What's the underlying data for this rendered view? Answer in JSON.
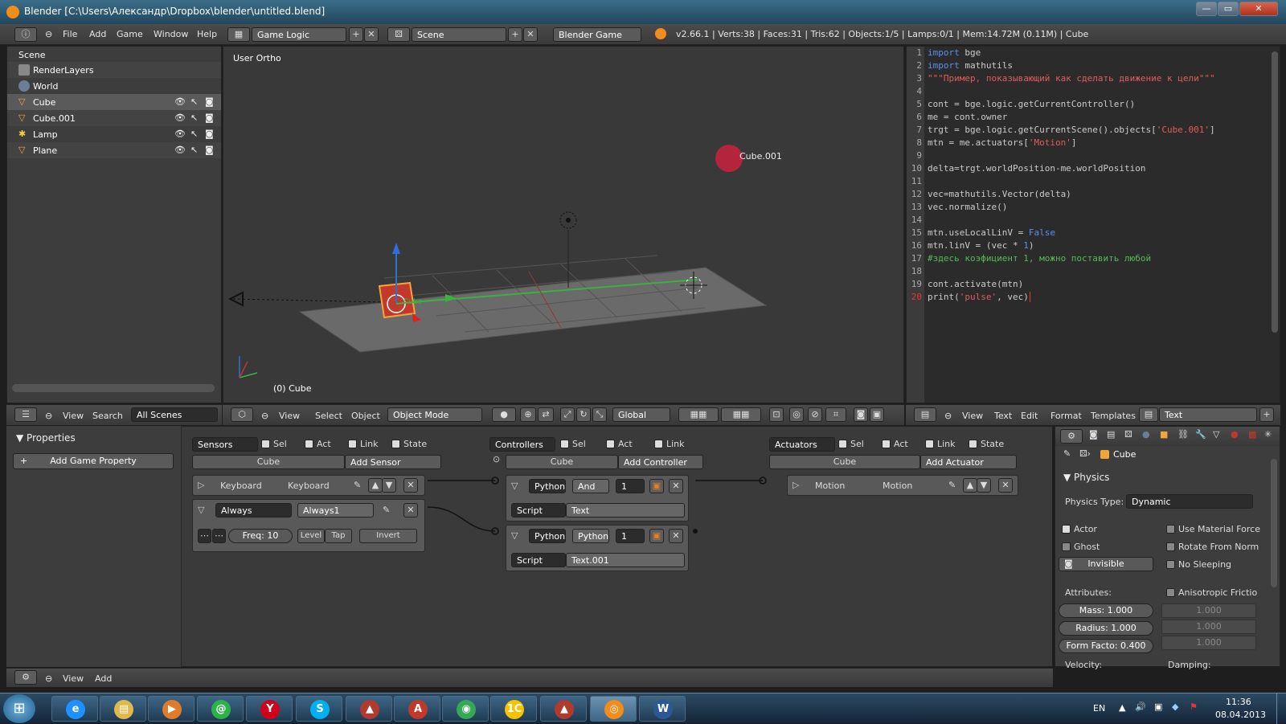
{
  "window": {
    "title": "Blender [C:\\Users\\Александр\\Dropbox\\blender\\untitled.blend]",
    "btn_min": "—",
    "btn_max": "▭",
    "btn_close": "✕"
  },
  "menubar": {
    "items": [
      "File",
      "Add",
      "Game",
      "Window",
      "Help"
    ],
    "screen": "Game Logic",
    "scene": "Scene",
    "engine": "Blender Game",
    "stats": "v2.66.1 | Verts:38 | Faces:31 | Tris:62 | Objects:1/5 | Lamps:0/1 | Mem:14.72M (0.11M) | Cube"
  },
  "outliner": {
    "scene": "Scene",
    "items": [
      {
        "label": "RenderLayers"
      },
      {
        "label": "World"
      },
      {
        "label": "Cube"
      },
      {
        "label": "Cube.001"
      },
      {
        "label": "Lamp"
      },
      {
        "label": "Plane"
      }
    ],
    "header": {
      "view": "View",
      "search": "Search",
      "filter": "All Scenes"
    }
  },
  "viewport": {
    "view_label": "User Ortho",
    "object_label": "(0) Cube",
    "cube_label": "Cube",
    "target_label": "Cube.001",
    "header": {
      "view": "View",
      "select": "Select",
      "object": "Object",
      "mode": "Object Mode",
      "orientation": "Global"
    },
    "colors": {
      "cube": "#c0392b",
      "target": "#b5243d",
      "x_axis": "#c0392b",
      "y_axis": "#3cb043",
      "z_axis": "#2f6fd6"
    }
  },
  "texteditor": {
    "line_numbers": [
      "1",
      "2",
      "3",
      "4",
      "5",
      "6",
      "7",
      "8",
      "9",
      "10",
      "11",
      "12",
      "13",
      "14",
      "15",
      "16",
      "17",
      "18",
      "19",
      "20"
    ],
    "header": {
      "view": "View",
      "text": "Text",
      "edit": "Edit",
      "format": "Format",
      "templates": "Templates",
      "datablock": "Text"
    }
  },
  "logic": {
    "properties_title": "Properties",
    "add_game_property": "Add Game Property",
    "sensors": {
      "title": "Sensors",
      "sel": "Sel",
      "act": "Act",
      "link": "Link",
      "state": "State",
      "object": "Cube",
      "add": "Add Sensor",
      "b1_type": "Keyboard",
      "b1_name": "Keyboard",
      "b2_type": "Always",
      "b2_name": "Always1",
      "freq": "Freq: 10",
      "level": "Level",
      "tap": "Tap",
      "invert": "Invert"
    },
    "controllers": {
      "title": "Controllers",
      "sel": "Sel",
      "act": "Act",
      "link": "Link",
      "object": "Cube",
      "add": "Add Controller",
      "c1_type": "Python",
      "c1_name": "And",
      "c1_state": "1",
      "c1_mode": "Script",
      "c1_script": "Text",
      "c2_type": "Python",
      "c2_name": "Python",
      "c2_state": "1",
      "c2_mode": "Script",
      "c2_script": "Text.001"
    },
    "actuators": {
      "title": "Actuators",
      "sel": "Sel",
      "act": "Act",
      "link": "Link",
      "state": "State",
      "object": "Cube",
      "add": "Add Actuator",
      "a1_type": "Motion",
      "a1_name": "Motion"
    },
    "header": {
      "view": "View",
      "add": "Add"
    }
  },
  "props_right": {
    "object": "Cube",
    "physics_title": "Physics",
    "physics_type_label": "Physics Type:",
    "physics_type": "Dynamic",
    "actor": "Actor",
    "ghost": "Ghost",
    "invisible": "Invisible",
    "use_material_force": "Use Material Force",
    "rotate_from_norm": "Rotate From Norm",
    "no_sleeping": "No Sleeping",
    "attributes": "Attributes:",
    "anisotropic": "Anisotropic Frictio",
    "mass": "Mass: 1.000",
    "radius": "Radius: 1.000",
    "form_factor": "Form Facto: 0.400",
    "aniso_x": "1.000",
    "aniso_y": "1.000",
    "aniso_z": "1.000",
    "velocity": "Velocity:",
    "damping": "Damping:"
  },
  "taskbar": {
    "start": "⊞",
    "apps": [
      {
        "glyph": "e",
        "color": "#1e90ff"
      },
      {
        "glyph": "▤",
        "color": "#e2b84a"
      },
      {
        "glyph": "▶",
        "color": "#e07b2a"
      },
      {
        "glyph": "@",
        "color": "#2bb34a"
      },
      {
        "glyph": "Y",
        "color": "#d0021b"
      },
      {
        "glyph": "S",
        "color": "#00aff0"
      },
      {
        "glyph": "▲",
        "color": "#b03a2e"
      },
      {
        "glyph": "A",
        "color": "#c0392b"
      },
      {
        "glyph": "◉",
        "color": "#34a853"
      },
      {
        "glyph": "1C",
        "color": "#f5c400"
      },
      {
        "glyph": "▲",
        "color": "#b03a2e"
      },
      {
        "glyph": "◎",
        "color": "#f28c1b"
      },
      {
        "glyph": "W",
        "color": "#2b5797"
      }
    ],
    "lang": "EN",
    "time": "11:36",
    "date": "08.04.2013"
  }
}
